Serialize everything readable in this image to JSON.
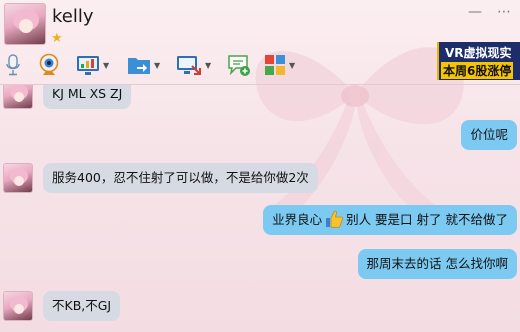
{
  "header": {
    "username": "kelly",
    "level_icon": "star-icon",
    "minimize_glyph": "—",
    "more_glyph": "⋯"
  },
  "toolbar": {
    "items": [
      {
        "name": "voice-call",
        "icon": "microphone-icon"
      },
      {
        "name": "video-call",
        "icon": "webcam-icon"
      },
      {
        "name": "remote-desktop",
        "icon": "monitor-icon"
      },
      {
        "name": "send-file",
        "icon": "folder-icon"
      },
      {
        "name": "screen-share",
        "icon": "screen-share-icon"
      },
      {
        "name": "new-discussion",
        "icon": "chat-add-icon"
      },
      {
        "name": "apps",
        "icon": "apps-grid-icon"
      }
    ]
  },
  "ad": {
    "line1": "VR虚拟现实",
    "line2": "本周6股涨停"
  },
  "messages": [
    {
      "side": "in",
      "text": "KJ ML XS ZJ"
    },
    {
      "side": "out",
      "text": "价位呢"
    },
    {
      "side": "in",
      "text": "服务400，忍不住射了可以做，不是给你做2次"
    },
    {
      "side": "out",
      "text_before": "业界良心",
      "emoji": "thumbs-up-icon",
      "text_after": "别人 要是口 射了  就不给做了"
    },
    {
      "side": "out",
      "text": "那周末去的话 怎么找你啊"
    },
    {
      "side": "in",
      "text": "不KB,不GJ"
    }
  ],
  "colors": {
    "incoming_bubble": "#d6dbe3",
    "outgoing_bubble": "#7ccaf2",
    "background": "#f7e6ea",
    "ad_background": "#1c2d6a",
    "ad_accent": "#f7c400"
  }
}
